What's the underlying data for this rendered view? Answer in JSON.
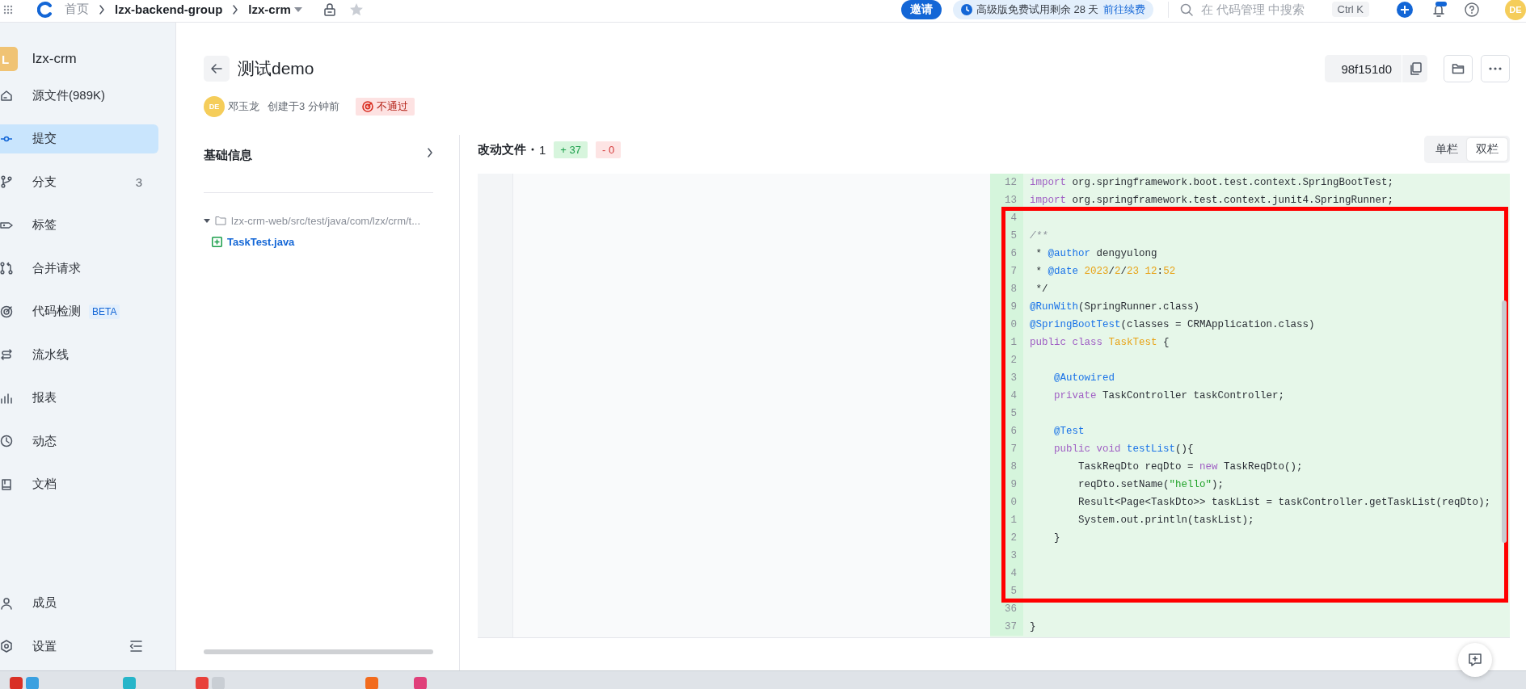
{
  "topbar": {
    "breadcrumbs": [
      {
        "label": "首页",
        "kind": "link"
      },
      {
        "label": "lzx-backend-group",
        "kind": "link"
      },
      {
        "label": "lzx-crm",
        "kind": "dropdown"
      }
    ],
    "invite_button": "邀请",
    "trial": {
      "text": "高级版免费试用剩余 28 天",
      "link": "前往续费"
    },
    "search": {
      "placeholder": "在 代码管理 中搜索",
      "shortcut": "Ctrl K"
    },
    "avatar": "DE"
  },
  "sidebar": {
    "project": {
      "initial": "L",
      "name": "lzx-crm"
    },
    "items": [
      {
        "label": "源文件(989K)",
        "selected": false
      },
      {
        "label": "提交",
        "selected": true
      },
      {
        "label": "分支",
        "selected": false,
        "count": "3"
      },
      {
        "label": "标签",
        "selected": false
      },
      {
        "label": "合并请求",
        "selected": false
      },
      {
        "label": "代码检测",
        "selected": false,
        "badge": "BETA"
      },
      {
        "label": "流水线",
        "selected": false
      },
      {
        "label": "报表",
        "selected": false
      },
      {
        "label": "动态",
        "selected": false
      },
      {
        "label": "文档",
        "selected": false
      }
    ],
    "bottom_items": [
      {
        "label": "成员",
        "selected": false
      },
      {
        "label": "设置",
        "selected": false
      }
    ]
  },
  "commit": {
    "title": "测试demo",
    "hash": "98f151d0",
    "author_initials": "DE",
    "author": "邓玉龙",
    "created": "创建于3 分钟前",
    "status": {
      "label": "不通过",
      "kind": "failed"
    }
  },
  "info_panel": {
    "title": "基础信息",
    "tree": [
      {
        "label": "lzx-crm-web/src/test/java/com/lzx/crm/t...",
        "kind": "folder",
        "expanded": true,
        "children": [
          {
            "label": "TaskTest.java",
            "kind": "added-file"
          }
        ]
      }
    ]
  },
  "changes": {
    "title": "改动文件",
    "count": "1",
    "added": "+ 37",
    "removed": "- 0",
    "view_modes": [
      {
        "label": "单栏",
        "selected": false
      },
      {
        "label": "双栏",
        "selected": true
      }
    ],
    "lines_above": [
      {
        "num": "12",
        "tokens": [
          {
            "text": "import",
            "kind": "keyword"
          },
          {
            "text": " org.springframework.boot.test.context.SpringBootTest;",
            "kind": "plain"
          }
        ]
      },
      {
        "num": "13",
        "tokens": [
          {
            "text": "import",
            "kind": "keyword"
          },
          {
            "text": " org.springframework.test.context.junit4.SpringRunner;",
            "kind": "plain"
          }
        ]
      }
    ],
    "annotation": {
      "kind": "red-box",
      "lines": [
        {
          "num": "4"
        },
        {
          "num": "5",
          "tokens": [
            {
              "text": "/**",
              "kind": "comment"
            }
          ]
        },
        {
          "num": "6",
          "tokens": [
            {
              "text": " *",
              "kind": "plain"
            },
            {
              "text": " @author",
              "kind": "annotation"
            },
            {
              "text": " dengyulong",
              "kind": "plain"
            }
          ]
        },
        {
          "num": "7",
          "tokens": [
            {
              "text": " *",
              "kind": "plain"
            },
            {
              "text": " @date",
              "kind": "annotation"
            },
            {
              "text": " 2023",
              "kind": "number"
            },
            {
              "text": "/",
              "kind": "plain"
            },
            {
              "text": "2",
              "kind": "number"
            },
            {
              "text": "/",
              "kind": "plain"
            },
            {
              "text": "23 12",
              "kind": "number"
            },
            {
              "text": ":",
              "kind": "plain"
            },
            {
              "text": "52",
              "kind": "number"
            }
          ]
        },
        {
          "num": "8",
          "tokens": [
            {
              "text": " */",
              "kind": "plain"
            }
          ]
        },
        {
          "num": "9",
          "tokens": [
            {
              "text": "@RunWith",
              "kind": "annotation"
            },
            {
              "text": "(SpringRunner.class)",
              "kind": "plain"
            }
          ]
        },
        {
          "num": "0",
          "tokens": [
            {
              "text": "@SpringBootTest",
              "kind": "annotation"
            },
            {
              "text": "(classes = CRMApplication.class)",
              "kind": "plain"
            }
          ]
        },
        {
          "num": "1",
          "tokens": [
            {
              "text": "public class",
              "kind": "keyword"
            },
            {
              "text": " TaskTest",
              "kind": "type"
            },
            {
              "text": " {",
              "kind": "plain"
            }
          ]
        },
        {
          "num": "2"
        },
        {
          "num": "3",
          "tokens": [
            {
              "text": "    @Autowired",
              "kind": "annotation"
            }
          ]
        },
        {
          "num": "4",
          "tokens": [
            {
              "text": "    private",
              "kind": "keyword"
            },
            {
              "text": " TaskController taskController;",
              "kind": "plain"
            }
          ]
        },
        {
          "num": "5"
        },
        {
          "num": "6",
          "tokens": [
            {
              "text": "    @Test",
              "kind": "annotation"
            }
          ]
        },
        {
          "num": "7",
          "tokens": [
            {
              "text": "    public void",
              "kind": "keyword"
            },
            {
              "text": " testList",
              "kind": "function"
            },
            {
              "text": "(){",
              "kind": "plain"
            }
          ]
        },
        {
          "num": "8",
          "tokens": [
            {
              "text": "        TaskReqDto reqDto = ",
              "kind": "plain"
            },
            {
              "text": "new",
              "kind": "keyword"
            },
            {
              "text": " TaskReqDto();",
              "kind": "plain"
            }
          ]
        },
        {
          "num": "9",
          "tokens": [
            {
              "text": "        reqDto.setName(",
              "kind": "plain"
            },
            {
              "text": "\"hello\"",
              "kind": "string"
            },
            {
              "text": ");",
              "kind": "plain"
            }
          ]
        },
        {
          "num": "0",
          "tokens": [
            {
              "text": "        Result<Page<TaskDto>> taskList = taskController.getTaskList(reqDto);",
              "kind": "plain"
            }
          ]
        },
        {
          "num": "1",
          "tokens": [
            {
              "text": "        System.out.println(taskList);",
              "kind": "plain"
            }
          ]
        },
        {
          "num": "2",
          "tokens": [
            {
              "text": "    }",
              "kind": "plain"
            }
          ]
        },
        {
          "num": "3"
        },
        {
          "num": "4"
        },
        {
          "num": "5"
        }
      ]
    },
    "lines_below": [
      {
        "num": "36"
      },
      {
        "num": "37",
        "tokens": [
          {
            "text": "}",
            "kind": "plain"
          }
        ]
      }
    ]
  }
}
